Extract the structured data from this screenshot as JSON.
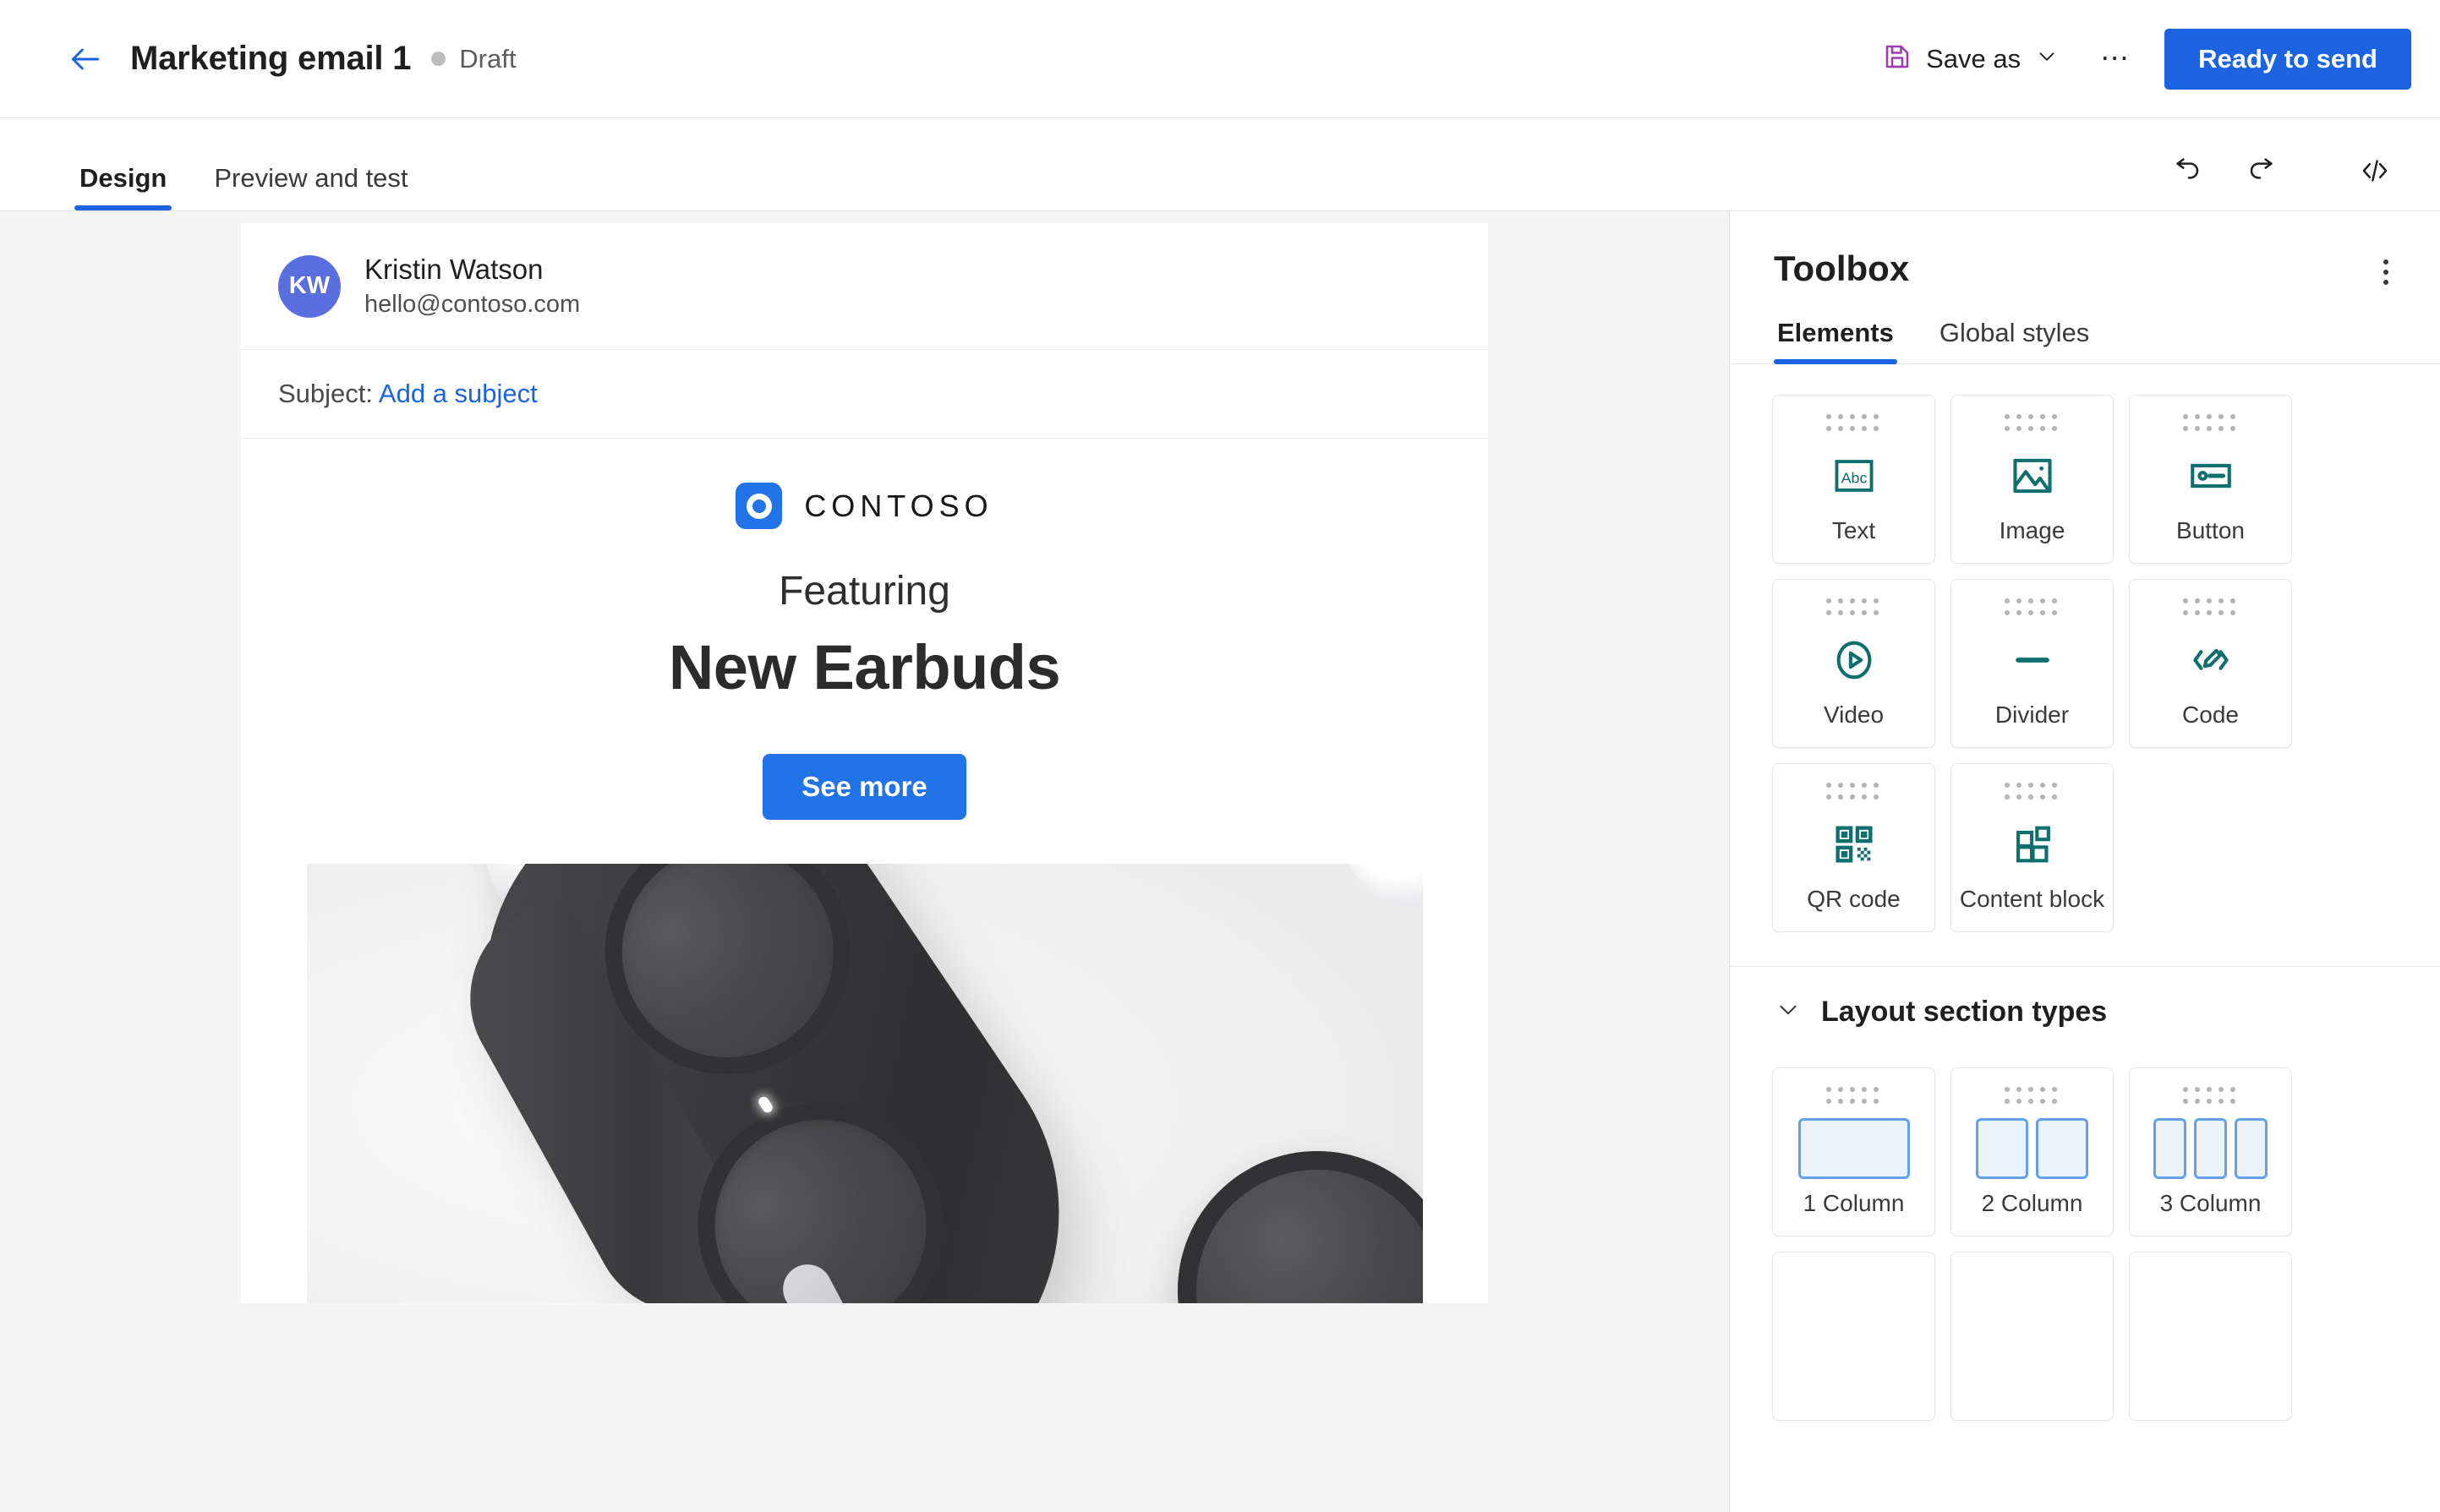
{
  "topbar": {
    "back_icon": "arrow-left-icon",
    "title": "Marketing email 1",
    "status": "Draft",
    "save_icon": "floppy-disk-icon",
    "save_label": "Save as",
    "save_chevron": "chevron-down-icon",
    "more_label": "⋯",
    "primary_button": "Ready to send",
    "accent_color": "#1b63e0",
    "save_icon_color": "#9c3db5"
  },
  "tabbar": {
    "tabs": [
      {
        "label": "Design",
        "active": true
      },
      {
        "label": "Preview and test",
        "active": false
      }
    ],
    "actions": [
      {
        "name": "undo-icon"
      },
      {
        "name": "redo-icon"
      },
      {
        "name": "code-view-icon"
      }
    ]
  },
  "email": {
    "sender": {
      "initials": "KW",
      "name": "Kristin Watson",
      "address": "hello@contoso.com",
      "avatar_color": "#5b6ee0"
    },
    "subject_label": "Subject:",
    "subject_link": "Add a subject",
    "brand": {
      "logo_icon": "contoso-ring-logo",
      "name": "CONTOSO",
      "logo_color": "#2272e8"
    },
    "eyebrow": "Featuring",
    "headline": "New Earbuds",
    "cta_label": "See more",
    "cta_color": "#2272e8",
    "hero_alt": "black wireless earbuds in charging case on light gray background"
  },
  "toolbox": {
    "title": "Toolbox",
    "kebab_icon": "more-vertical-icon",
    "tabs": [
      {
        "label": "Elements",
        "active": true
      },
      {
        "label": "Global styles",
        "active": false
      }
    ],
    "icon_color": "#0f6e6e",
    "elements": [
      {
        "label": "Text",
        "icon": "abc-text-icon"
      },
      {
        "label": "Image",
        "icon": "image-icon"
      },
      {
        "label": "Button",
        "icon": "button-icon"
      },
      {
        "label": "Video",
        "icon": "play-circle-icon"
      },
      {
        "label": "Divider",
        "icon": "divider-icon"
      },
      {
        "label": "Code",
        "icon": "code-pencil-icon"
      },
      {
        "label": "QR code",
        "icon": "qr-code-icon"
      },
      {
        "label": "Content block",
        "icon": "content-block-icon"
      }
    ],
    "layout_section": {
      "chevron_icon": "chevron-down-icon",
      "title": "Layout section types",
      "items": [
        {
          "label": "1 Column",
          "columns": 1
        },
        {
          "label": "2 Column",
          "columns": 2
        },
        {
          "label": "3 Column",
          "columns": 3
        }
      ]
    }
  }
}
